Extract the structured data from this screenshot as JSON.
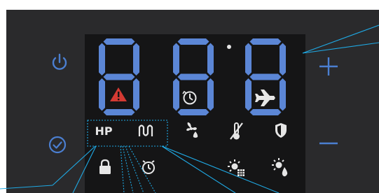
{
  "colors": {
    "panel": "#2a2a2c",
    "display": "#151516",
    "segment": "#5b86d6",
    "icon": "#e6e6e6",
    "button_icon": "#4b7fd1",
    "warning": "#d43a33",
    "callout": "#1fa9e4"
  },
  "display": {
    "digits": [
      "8",
      "8",
      "8"
    ],
    "dot_visible": true
  },
  "controls": {
    "power": {
      "icon": "power-icon"
    },
    "confirm": {
      "icon": "check-circle-icon"
    },
    "plus": {
      "icon": "plus-icon"
    },
    "minus": {
      "icon": "minus-icon"
    }
  },
  "labels": {
    "hp": "HP"
  },
  "indicators": [
    {
      "name": "warning-icon"
    },
    {
      "name": "clock-icon"
    },
    {
      "name": "airplane-icon"
    },
    {
      "name": "heat-pump-icon"
    },
    {
      "name": "heater-coil-icon"
    },
    {
      "name": "fan-drop-icon"
    },
    {
      "name": "thermometer-icon"
    },
    {
      "name": "shield-icon"
    },
    {
      "name": "lock-icon"
    },
    {
      "name": "alarm-clock-icon"
    },
    {
      "name": "sun-grid-icon"
    },
    {
      "name": "sun-drop-icon"
    }
  ]
}
